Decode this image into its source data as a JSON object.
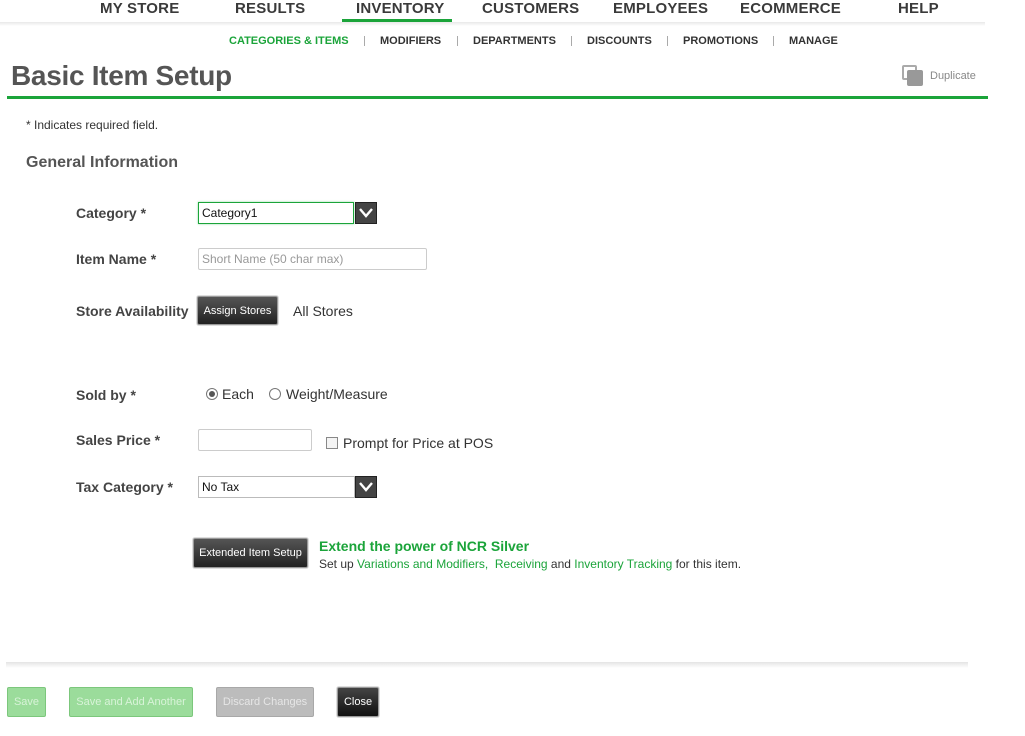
{
  "topnav": {
    "items": [
      {
        "label": "MY STORE",
        "active": false
      },
      {
        "label": "RESULTS",
        "active": false
      },
      {
        "label": "INVENTORY",
        "active": true
      },
      {
        "label": "CUSTOMERS",
        "active": false
      },
      {
        "label": "EMPLOYEES",
        "active": false
      },
      {
        "label": "ECOMMERCE",
        "active": false
      },
      {
        "label": "HELP",
        "active": false
      }
    ]
  },
  "subnav": {
    "items": [
      {
        "label": "CATEGORIES & ITEMS",
        "active": true
      },
      {
        "label": "MODIFIERS",
        "active": false
      },
      {
        "label": "DEPARTMENTS",
        "active": false
      },
      {
        "label": "DISCOUNTS",
        "active": false
      },
      {
        "label": "PROMOTIONS",
        "active": false
      },
      {
        "label": "MANAGE",
        "active": false
      }
    ]
  },
  "page": {
    "title": "Basic Item Setup",
    "duplicate_label": "Duplicate",
    "required_note": "* Indicates required field.",
    "section_title": "General Information"
  },
  "form": {
    "category": {
      "label": "Category *",
      "value": "Category1"
    },
    "item_name": {
      "label": "Item Name *",
      "placeholder": "Short Name (50 char max)",
      "value": ""
    },
    "store_availability": {
      "label": "Store Availability",
      "button": "Assign Stores",
      "value": "All Stores"
    },
    "sold_by": {
      "label": "Sold by *",
      "options": [
        "Each",
        "Weight/Measure"
      ],
      "selected": "Each"
    },
    "sales_price": {
      "label": "Sales Price *",
      "value": "",
      "prompt_label": "Prompt for Price at POS",
      "prompt_checked": false
    },
    "tax_category": {
      "label": "Tax Category *",
      "value": "No Tax"
    }
  },
  "extended": {
    "button": "Extended Item Setup",
    "title": "Extend the power of NCR Silver",
    "prefix": "Set up ",
    "link1": "Variations and Modifiers,",
    "link2": "Receiving",
    "and": " and ",
    "link3": "Inventory Tracking",
    "suffix": " for this item."
  },
  "footer": {
    "save": "Save",
    "save_add": "Save and Add Another",
    "discard": "Discard Changes",
    "close": "Close"
  },
  "colors": {
    "accent": "#1ba43a",
    "dark_button": "#333333"
  }
}
